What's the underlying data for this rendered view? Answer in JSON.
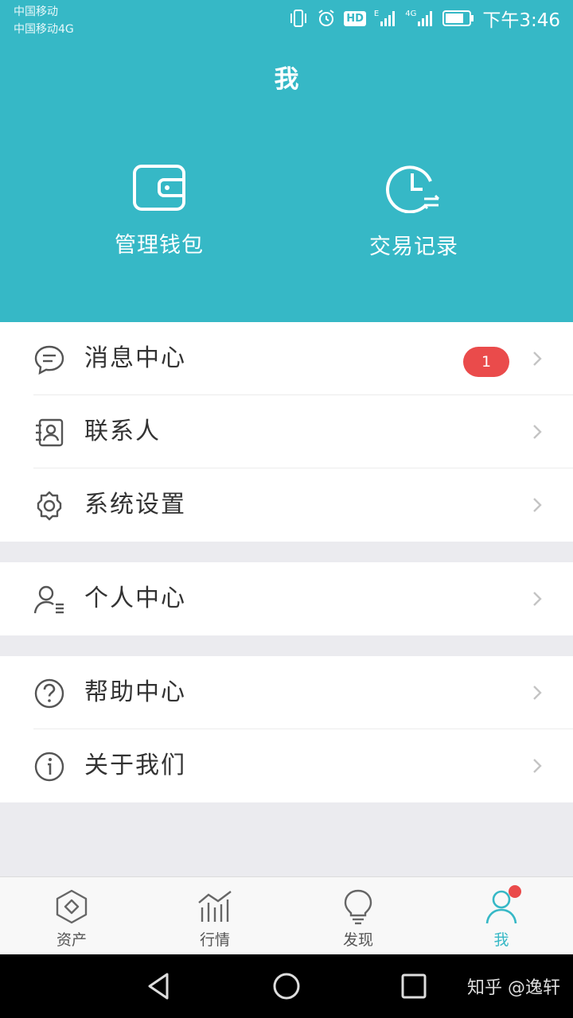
{
  "status_bar": {
    "carrier_1": "中国移动",
    "carrier_2": "中国移动4G",
    "hd_badge": "HD",
    "network_e": "E",
    "network_4g": "4G",
    "time": "下午3:46"
  },
  "header": {
    "title": "我",
    "actions": [
      {
        "label": "管理钱包",
        "icon": "wallet-icon"
      },
      {
        "label": "交易记录",
        "icon": "clock-icon"
      }
    ]
  },
  "groups": {
    "group1": [
      {
        "label": "消息中心",
        "icon": "message-icon",
        "badge": "1"
      },
      {
        "label": "联系人",
        "icon": "contacts-icon"
      },
      {
        "label": "系统设置",
        "icon": "gear-icon"
      }
    ],
    "group2": [
      {
        "label": "个人中心",
        "icon": "person-icon"
      }
    ],
    "group3": [
      {
        "label": "帮助中心",
        "icon": "help-icon"
      },
      {
        "label": "关于我们",
        "icon": "info-icon"
      }
    ]
  },
  "tabbar": {
    "tabs": [
      {
        "label": "资产",
        "icon": "assets-icon"
      },
      {
        "label": "行情",
        "icon": "market-chart-icon"
      },
      {
        "label": "发现",
        "icon": "bulb-icon"
      },
      {
        "label": "我",
        "icon": "profile-icon",
        "active": true
      }
    ]
  },
  "watermark": "知乎 @逸轩",
  "colors": {
    "primary": "#36b8c6",
    "badge": "#ea4b4b",
    "background": "#ebebef"
  }
}
